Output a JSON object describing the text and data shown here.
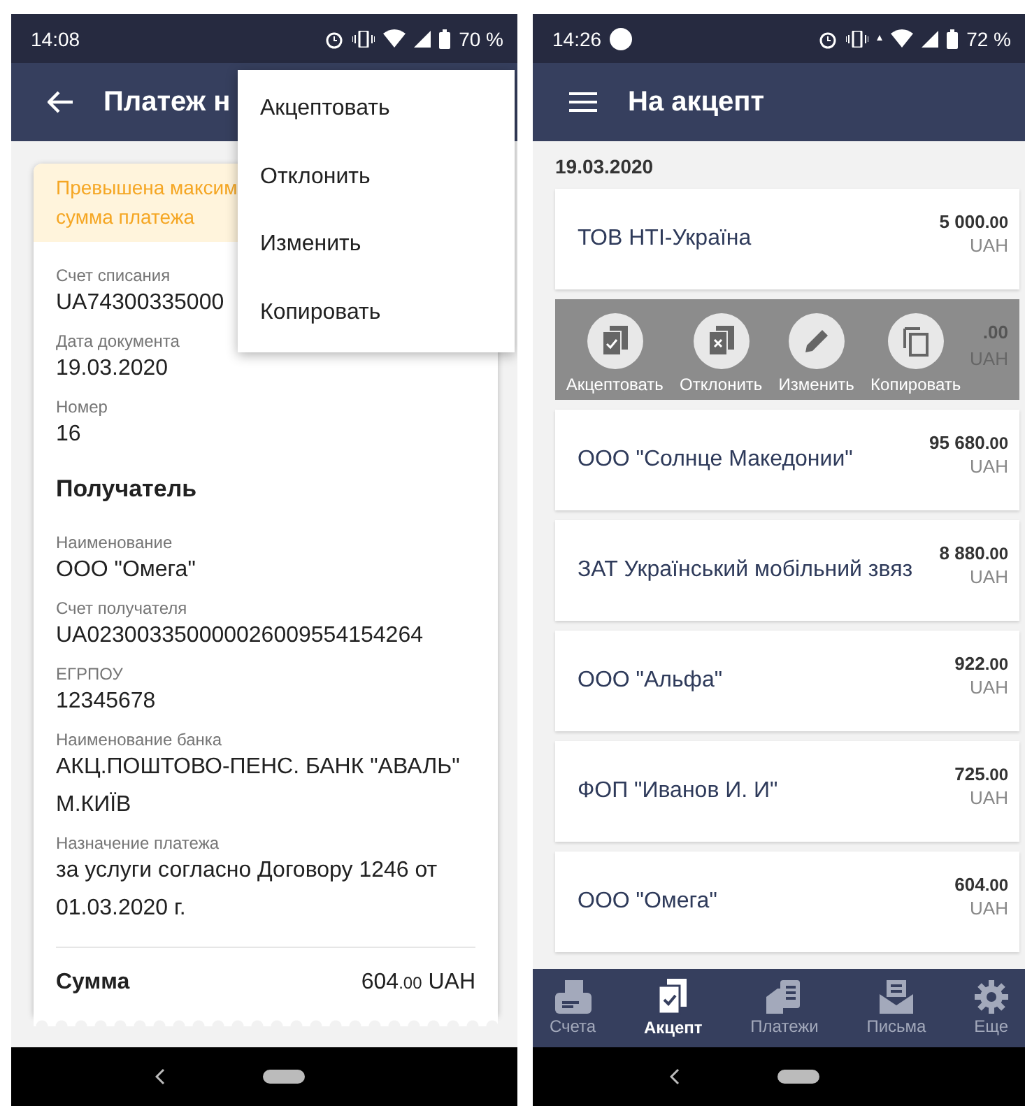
{
  "left": {
    "status_bar": {
      "time": "14:08",
      "battery": "70 %"
    },
    "app_bar": {
      "title": "Платеж н"
    },
    "warning": [
      "Превышена максим",
      "сумма платежа"
    ],
    "fields": [
      {
        "kind": "field",
        "label": "Счет списания",
        "value": "UA74300335000"
      },
      {
        "kind": "field",
        "label": "Дата документа",
        "value": "19.03.2020"
      },
      {
        "kind": "field",
        "label": "Номер",
        "value": "16"
      },
      {
        "kind": "heading",
        "value": "Получатель"
      },
      {
        "kind": "field",
        "label": "Наименование",
        "value": "ООО \"Омега\""
      },
      {
        "kind": "field",
        "label": "Счет получателя",
        "value": "UA023003350000026009554154264"
      },
      {
        "kind": "field",
        "label": "ЕГРПОУ",
        "value": "12345678"
      },
      {
        "kind": "field",
        "label": "Наименование банка",
        "value": "АКЦ.ПОШТОВО-ПЕНС. БАНК \"АВАЛЬ\" М.КИЇВ"
      },
      {
        "kind": "field",
        "label": "Назначение платежа",
        "value": "за услуги согласно Договору 1246 от 01.03.2020 г."
      }
    ],
    "total": {
      "label": "Сумма",
      "amount": "604",
      "cents": ".00",
      "currency": "UAH"
    },
    "menu": [
      "Акцептовать",
      "Отклонить",
      "Изменить",
      "Копировать"
    ]
  },
  "right": {
    "status_bar": {
      "time": "14:26",
      "battery": "72 %"
    },
    "app_bar": {
      "title": "На акцепт"
    },
    "date": "19.03.2020",
    "rows": [
      {
        "kind": "payment",
        "name": "ТОВ НТІ-Україна",
        "amount": "5 000",
        "cents": ".00",
        "currency": "UAH"
      },
      {
        "kind": "swiped",
        "cents": ".00",
        "currency": "UAH",
        "actions": [
          {
            "label": "Акцептовать"
          },
          {
            "label": "Отклонить"
          },
          {
            "label": "Изменить"
          },
          {
            "label": "Копировать"
          }
        ]
      },
      {
        "kind": "payment",
        "name": "ООО \"Солнце Македонии\"",
        "amount": "95 680",
        "cents": ".00",
        "currency": "UAH"
      },
      {
        "kind": "payment",
        "name": "ЗАТ Український мобільний звяз",
        "amount": "8 880",
        "cents": ".00",
        "currency": "UAH"
      },
      {
        "kind": "payment",
        "name": "ООО \"Альфа\"",
        "amount": "922",
        "cents": ".00",
        "currency": "UAH"
      },
      {
        "kind": "payment",
        "name": "ФОП \"Иванов И. И\"",
        "amount": "725",
        "cents": ".00",
        "currency": "UAH"
      },
      {
        "kind": "payment",
        "name": "ООО \"Омега\"",
        "amount": "604",
        "cents": ".00",
        "currency": "UAH"
      }
    ],
    "bottom_nav": [
      {
        "label": "Счета",
        "selected": false
      },
      {
        "label": "Акцепт",
        "selected": true
      },
      {
        "label": "Платежи",
        "selected": false
      },
      {
        "label": "Письма",
        "selected": false
      },
      {
        "label": "Еще",
        "selected": false
      }
    ]
  }
}
